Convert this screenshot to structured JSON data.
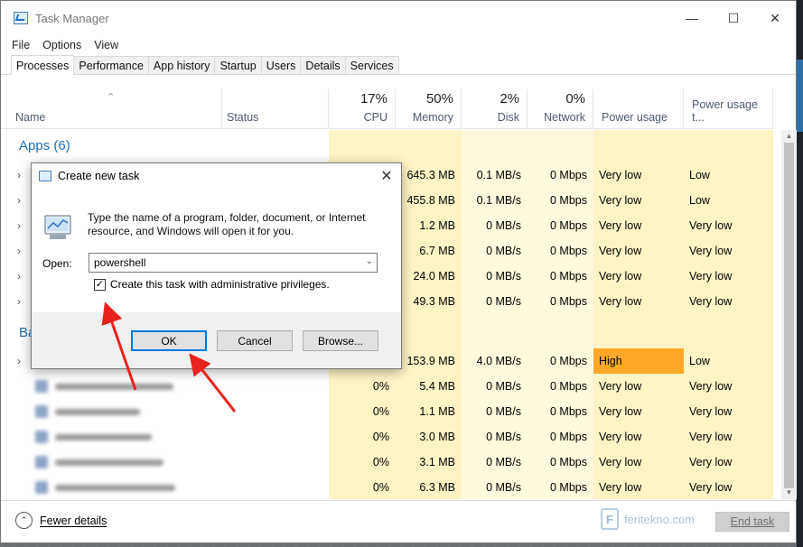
{
  "window": {
    "title": "Task Manager",
    "minimize": "—",
    "maximize": "☐",
    "close": "✕"
  },
  "menu": [
    "File",
    "Options",
    "View"
  ],
  "tabs": [
    "Processes",
    "Performance",
    "App history",
    "Startup",
    "Users",
    "Details",
    "Services"
  ],
  "columns": {
    "name": "Name",
    "status": "Status",
    "cpu": {
      "pct": "17%",
      "label": "CPU"
    },
    "memory": {
      "pct": "50%",
      "label": "Memory"
    },
    "disk": {
      "pct": "2%",
      "label": "Disk"
    },
    "network": {
      "pct": "0%",
      "label": "Network"
    },
    "power": "Power usage",
    "power_trend": "Power usage t..."
  },
  "sections": {
    "apps": "Apps (6)",
    "background_partial": "Ba"
  },
  "rows": [
    {
      "cpu": "",
      "memory": "645.3 MB",
      "disk": "0.1 MB/s",
      "network": "0 Mbps",
      "power": "Very low",
      "trend": "Low"
    },
    {
      "cpu": "",
      "memory": "455.8 MB",
      "disk": "0.1 MB/s",
      "network": "0 Mbps",
      "power": "Very low",
      "trend": "Low"
    },
    {
      "cpu": "",
      "memory": "1.2 MB",
      "disk": "0 MB/s",
      "network": "0 Mbps",
      "power": "Very low",
      "trend": "Very low"
    },
    {
      "cpu": "",
      "memory": "6.7 MB",
      "disk": "0 MB/s",
      "network": "0 Mbps",
      "power": "Very low",
      "trend": "Very low"
    },
    {
      "cpu": "",
      "memory": "24.0 MB",
      "disk": "0 MB/s",
      "network": "0 Mbps",
      "power": "Very low",
      "trend": "Very low"
    },
    {
      "cpu": "",
      "memory": "49.3 MB",
      "disk": "0 MB/s",
      "network": "0 Mbps",
      "power": "Very low",
      "trend": "Very low"
    },
    {
      "cpu": "",
      "memory": "153.9 MB",
      "disk": "4.0 MB/s",
      "network": "0 Mbps",
      "power": "High",
      "trend": "Low"
    },
    {
      "cpu": "0%",
      "memory": "5.4 MB",
      "disk": "0 MB/s",
      "network": "0 Mbps",
      "power": "Very low",
      "trend": "Very low"
    },
    {
      "cpu": "0%",
      "memory": "1.1 MB",
      "disk": "0 MB/s",
      "network": "0 Mbps",
      "power": "Very low",
      "trend": "Very low"
    },
    {
      "cpu": "0%",
      "memory": "3.0 MB",
      "disk": "0 MB/s",
      "network": "0 Mbps",
      "power": "Very low",
      "trend": "Very low"
    },
    {
      "cpu": "0%",
      "memory": "3.1 MB",
      "disk": "0 MB/s",
      "network": "0 Mbps",
      "power": "Very low",
      "trend": "Very low"
    },
    {
      "cpu": "0%",
      "memory": "6.3 MB",
      "disk": "0 MB/s",
      "network": "0 Mbps",
      "power": "Very low",
      "trend": "Very low"
    }
  ],
  "footer": {
    "fewer_details": "Fewer details",
    "end_task": "End task",
    "brand": "feritekno.com",
    "brand_mark": "F"
  },
  "dialog": {
    "title": "Create new task",
    "message": "Type the name of a program, folder, document, or Internet resource, and Windows will open it for you.",
    "open_label": "Open:",
    "open_value": "powershell",
    "admin_checkbox": "Create this task with administrative privileges.",
    "admin_checked": true,
    "ok": "OK",
    "cancel": "Cancel",
    "browse": "Browse...",
    "close": "✕"
  },
  "colors": {
    "high_power": "#ffa726",
    "shade": "#fff4c4",
    "section_blue": "#1f6fb2",
    "arrow_red": "#e8231e"
  }
}
